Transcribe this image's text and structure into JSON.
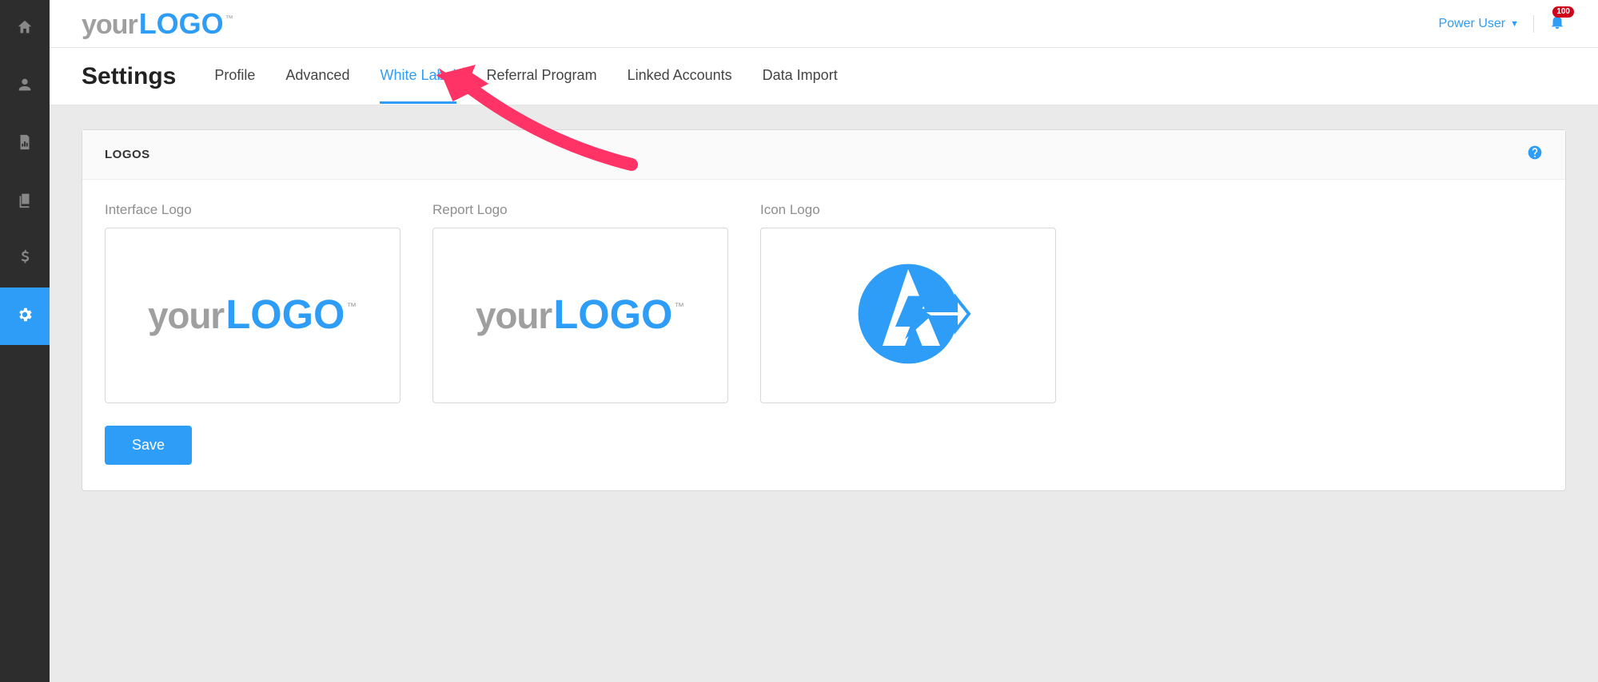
{
  "brand": {
    "part1": "your",
    "part2": "LOGO",
    "tm": "™"
  },
  "header": {
    "user_label": "Power User",
    "notification_count": "100"
  },
  "page": {
    "title": "Settings"
  },
  "tabs": [
    {
      "label": "Profile",
      "active": false
    },
    {
      "label": "Advanced",
      "active": false
    },
    {
      "label": "White Label",
      "active": true
    },
    {
      "label": "Referral Program",
      "active": false
    },
    {
      "label": "Linked Accounts",
      "active": false
    },
    {
      "label": "Data Import",
      "active": false
    }
  ],
  "panel": {
    "title": "LOGOS",
    "columns": [
      {
        "label": "Interface Logo"
      },
      {
        "label": "Report Logo"
      },
      {
        "label": "Icon Logo"
      }
    ],
    "save_label": "Save"
  }
}
